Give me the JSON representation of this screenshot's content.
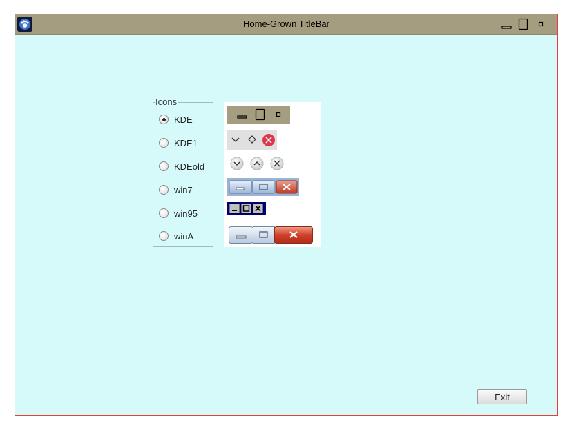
{
  "window": {
    "title": "Home-Grown TitleBar"
  },
  "icons_group": {
    "legend": "Icons",
    "selected": "KDE",
    "options": [
      "KDE",
      "KDE1",
      "KDEold",
      "win7",
      "win95",
      "winA"
    ]
  },
  "footer": {
    "exit_label": "Exit"
  },
  "colors": {
    "titlebar": "#a59d7f",
    "background": "#d6fafa",
    "border": "#e2403f"
  }
}
